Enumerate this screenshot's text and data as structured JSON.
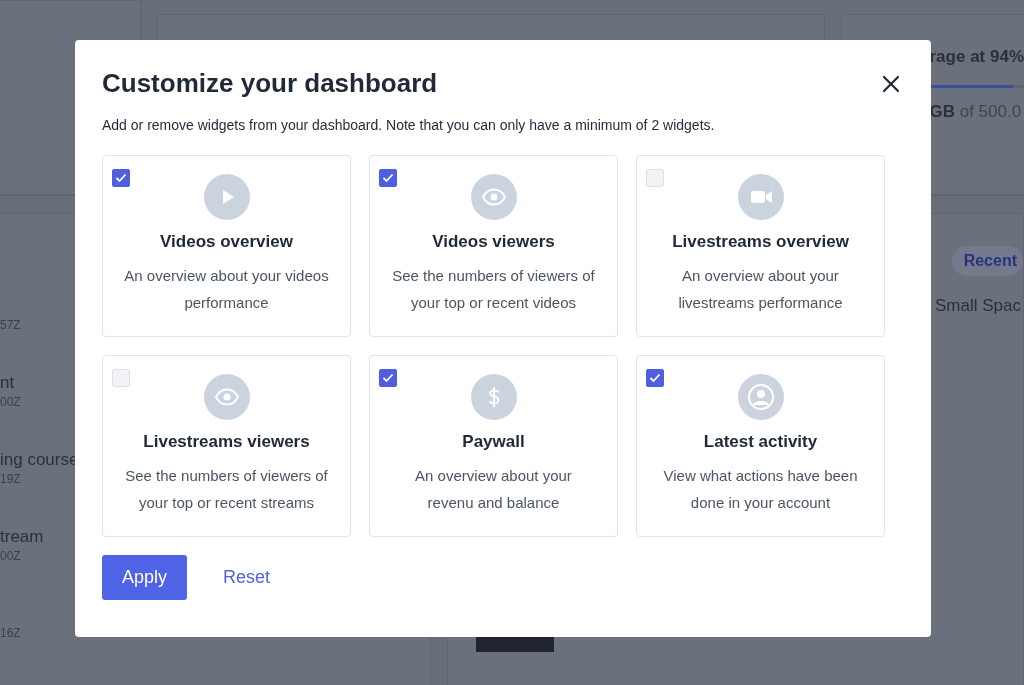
{
  "background": {
    "list_items": [
      {
        "time": "57Z"
      },
      {
        "title": "nt",
        "time": "00Z"
      },
      {
        "title": "ing course",
        "time": "19Z"
      },
      {
        "title": "tream",
        "time": "00Z"
      },
      {
        "time": "16Z"
      }
    ],
    "storage": {
      "title": "rage at 94%",
      "used": "GB",
      "total": "of 500.0",
      "level": 0.94
    },
    "recent": {
      "filter": "Recent",
      "item": "Small Spac"
    }
  },
  "dialog": {
    "title": "Customize your dashboard",
    "description": "Add or remove widgets from your dashboard. Note that you can only have a minimum of 2 widgets.",
    "widgets": [
      {
        "kind": "play",
        "title": "Videos overview",
        "description": "An overview about your videos performance",
        "checked": true
      },
      {
        "kind": "eye",
        "title": "Videos viewers",
        "description": "See the numbers of viewers of your top or recent videos",
        "checked": true
      },
      {
        "kind": "camera",
        "title": "Livestreams overview",
        "description": "An overview about your livestreams performance",
        "checked": false
      },
      {
        "kind": "eye",
        "title": "Livestreams viewers",
        "description": "See the numbers of viewers of your top or recent streams",
        "checked": false
      },
      {
        "kind": "dollar",
        "title": "Paywall",
        "description": "An overview about your revenu and balance",
        "checked": true
      },
      {
        "kind": "user",
        "title": "Latest activity",
        "description": "View what actions have been done in your account",
        "checked": true
      }
    ],
    "primary_button": "Apply",
    "secondary_button": "Reset"
  }
}
